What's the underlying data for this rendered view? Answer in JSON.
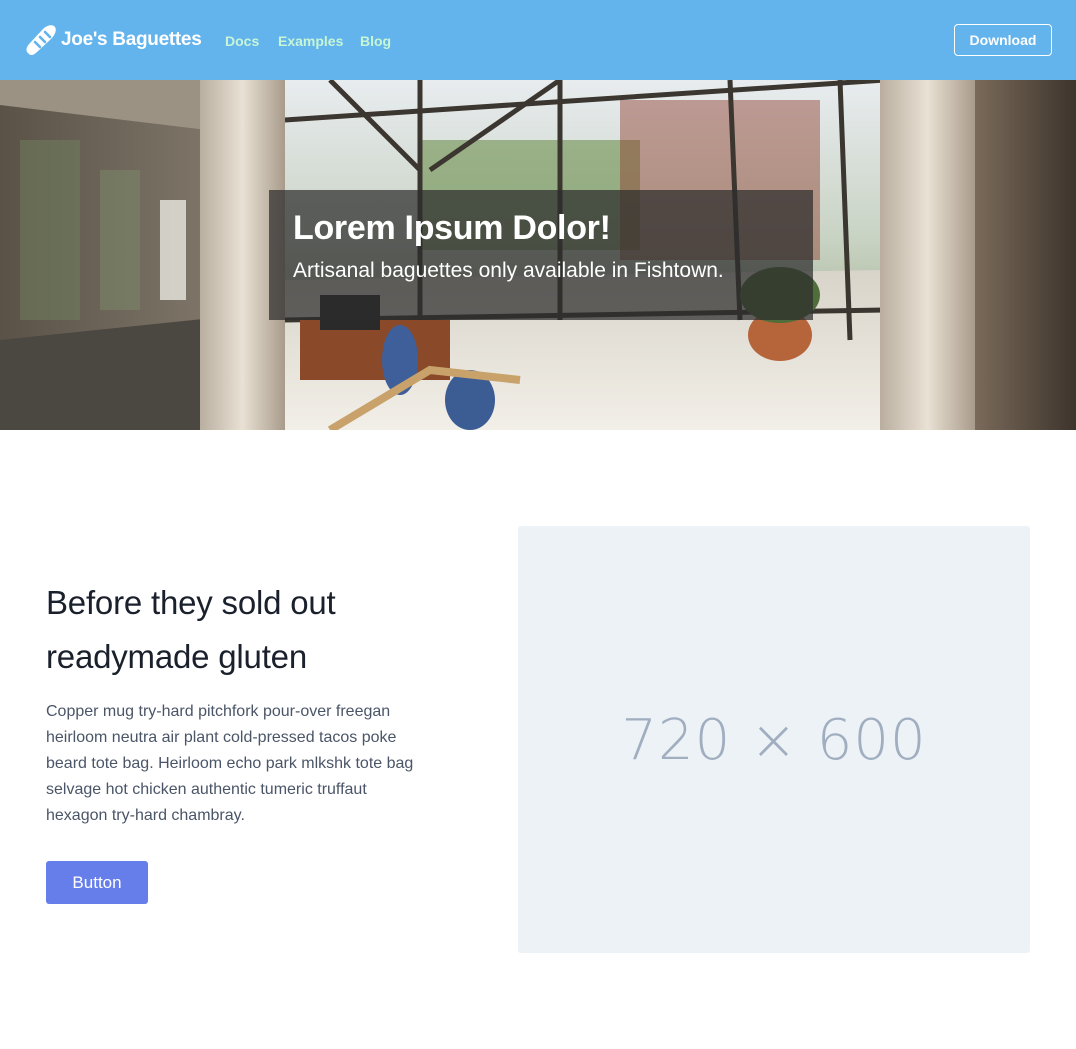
{
  "navbar": {
    "brand_name": "Joe's Baguettes",
    "brand_icon": "baguette-icon",
    "links": [
      {
        "label": "Docs"
      },
      {
        "label": "Examples"
      },
      {
        "label": "Blog"
      }
    ],
    "download_label": "Download",
    "background_color": "#63b3ed",
    "link_color": "#c6f6d5"
  },
  "hero": {
    "title": "Lorem Ipsum Dolor!",
    "subtitle": "Artisanal baguettes only available in Fishtown."
  },
  "feature": {
    "heading": "Before they sold out readymade gluten",
    "body": "Copper mug try-hard pitchfork pour-over freegan heirloom neutra air plant cold-pressed tacos poke beard tote bag. Heirloom echo park mlkshk tote bag selvage hot chicken authentic tumeric truffaut hexagon try-hard chambray.",
    "button_label": "Button",
    "button_color": "#667eea",
    "image_placeholder": "720 × 600"
  }
}
